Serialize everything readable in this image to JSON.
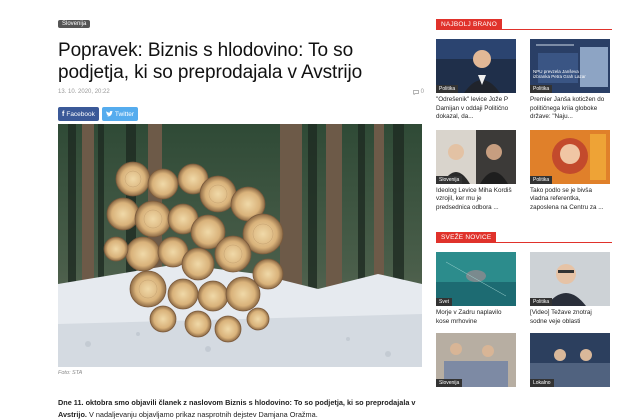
{
  "article": {
    "category": "Slovenija",
    "title": "Popravek: Biznis s hlodovino: To so podjetja, ki so preprodajala v Avstrijo",
    "date": "13. 10. 2020, 20:22",
    "comments": "0",
    "share": {
      "facebook": "Facebook",
      "twitter": "Twitter"
    },
    "image_caption": "Foto: STA",
    "lead_bold": "Dne 11. oktobra smo objavili članek z naslovom Biznis s hlodovino: To so podjetja, ki so preprodajala v Avstrijo.",
    "lead_rest": " V nadaljevanju objavljamo prikaz nasprotnih dejstev Damjana Oražma."
  },
  "sidebar": {
    "popular": {
      "heading": "NAJBOLJ BRANO",
      "items": [
        {
          "category": "Politika",
          "title": "\"Odrešenik\" levice Jože P Damijan v oddaji Politično dokazal, da..."
        },
        {
          "category": "Politika",
          "title": "Premier Janša koticžen do političnega kriia globoke države: \"Naju..."
        },
        {
          "category": "Slovenija",
          "title": "Ideolog Levice Miha Kordiš vzrojil, ker mu je predsednica odbora ..."
        },
        {
          "category": "Politika",
          "title": "Tako podlo se je bivša vladna referentka, zaposlena na Centru za ..."
        }
      ],
      "thumb2_text": "NPU prevzela Janševa izbranka Petra Grah Lazar"
    },
    "fresh": {
      "heading": "SVEŽE NOVICE",
      "items": [
        {
          "category": "Svet",
          "title": "Morje v Zadru naplavilo kose mrhovine"
        },
        {
          "category": "Politika",
          "title": "[Video] Težave znotraj sodne veje oblasti"
        },
        {
          "category": "Slovenija",
          "title": ""
        },
        {
          "category": "Lokalno",
          "title": ""
        }
      ]
    }
  },
  "colors": {
    "accent": "#e0322b",
    "facebook": "#3b5998",
    "twitter": "#55acee"
  }
}
